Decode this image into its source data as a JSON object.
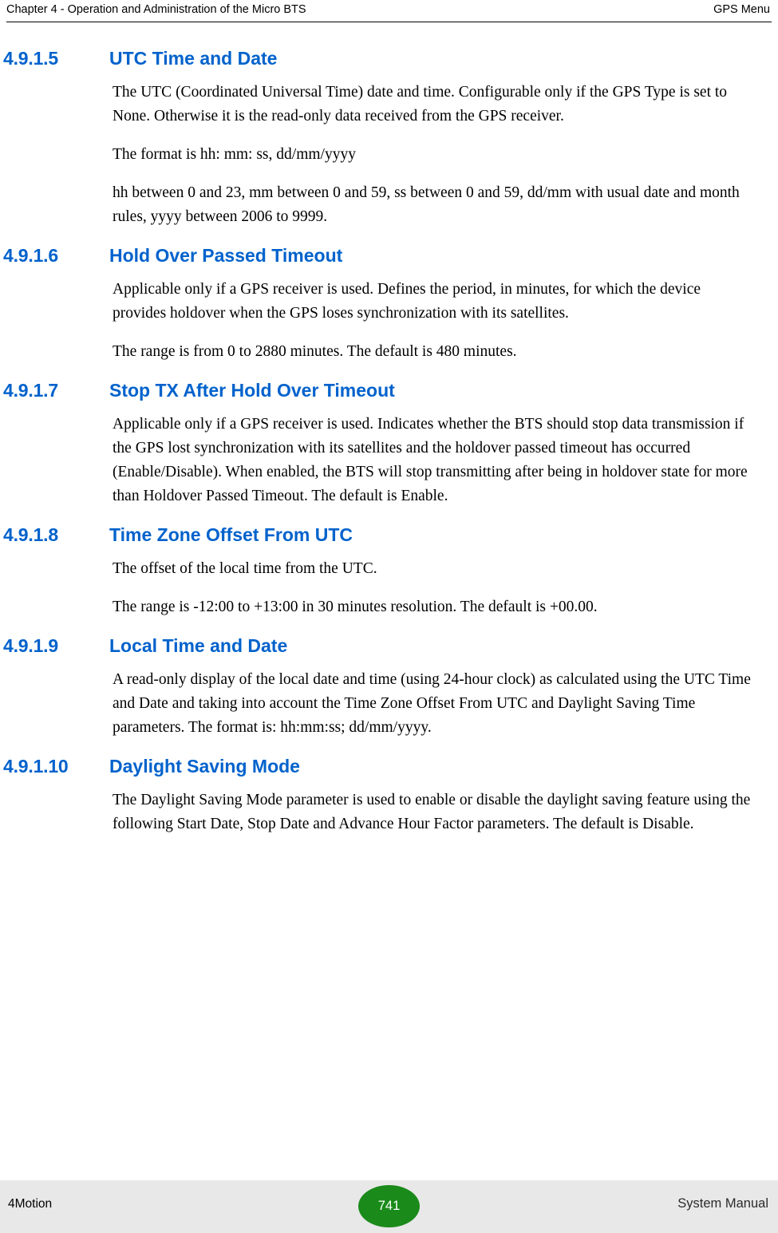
{
  "header": {
    "left": "Chapter 4 - Operation and Administration of the Micro BTS",
    "right": "GPS Menu"
  },
  "footer": {
    "left": "4Motion",
    "page_number": "741",
    "right": "System Manual"
  },
  "colors": {
    "heading": "#0062cc",
    "footer_bg": "#e8e8e8",
    "page_badge": "#1a8a1a"
  },
  "sections": [
    {
      "number": "4.9.1.5",
      "title": "UTC Time and Date",
      "paragraphs": [
        "The UTC (Coordinated Universal Time) date and time. Configurable only if the GPS Type is set to None. Otherwise it is the read-only data received from the GPS receiver.",
        "The format is hh: mm: ss, dd/mm/yyyy",
        "hh between 0 and 23, mm between 0 and 59, ss between 0 and 59, dd/mm with usual date and month rules, yyyy between 2006 to 9999."
      ]
    },
    {
      "number": "4.9.1.6",
      "title": "Hold Over Passed Timeout",
      "paragraphs": [
        "Applicable only if a GPS receiver is used. Defines the period, in minutes, for which the device provides holdover when the GPS loses synchronization with its satellites.",
        "The range is from 0 to 2880 minutes. The default is 480 minutes."
      ]
    },
    {
      "number": "4.9.1.7",
      "title": "Stop TX After Hold Over Timeout",
      "paragraphs": [
        "Applicable only if a GPS receiver is used. Indicates whether the BTS should stop data transmission if the GPS lost synchronization with its satellites and the holdover passed timeout has occurred (Enable/Disable). When enabled, the BTS will stop transmitting after being in holdover state for more than Holdover Passed Timeout. The default is Enable."
      ]
    },
    {
      "number": "4.9.1.8",
      "title": "Time Zone Offset From UTC",
      "paragraphs": [
        "The offset of the local time from the UTC.",
        "The range is -12:00 to +13:00 in 30 minutes resolution. The default is +00.00."
      ]
    },
    {
      "number": "4.9.1.9",
      "title": "Local Time and Date",
      "paragraphs": [
        "A read-only display of the local date and time (using 24-hour clock) as calculated using the UTC Time and Date and taking into account the Time Zone Offset From UTC and Daylight Saving Time parameters. The format is: hh:mm:ss; dd/mm/yyyy."
      ]
    },
    {
      "number": "4.9.1.10",
      "title": "Daylight Saving Mode",
      "paragraphs": [
        "The Daylight Saving Mode parameter is used to enable or disable the daylight saving feature using the following Start Date, Stop Date and Advance Hour Factor parameters. The default is Disable."
      ]
    }
  ]
}
